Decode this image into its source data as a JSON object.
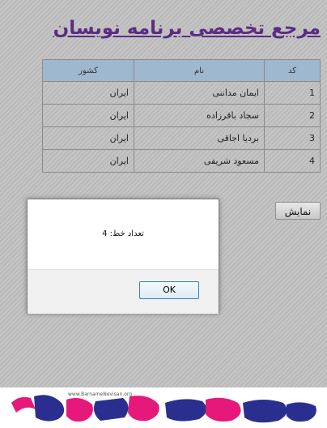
{
  "page": {
    "title": "مرجع تخصصی برنامه نویسان"
  },
  "table": {
    "headers": [
      "کد",
      "نام",
      "کشور"
    ],
    "rows": [
      {
        "code": "1",
        "name": "ایمان مداننی",
        "country": "ایران"
      },
      {
        "code": "2",
        "name": "سجاد باقرزاده",
        "country": "ایران"
      },
      {
        "code": "3",
        "name": "بردیا اجاقی",
        "country": "ایران"
      },
      {
        "code": "4",
        "name": "مسعود شریفی",
        "country": "ایران"
      }
    ]
  },
  "show_button": {
    "label": "نمایش"
  },
  "dialog": {
    "message": "تعداد خط: 4",
    "ok_label": "OK"
  },
  "footer_logo": {
    "url_text": "www.BarnameNevisan.org",
    "brand_text": "برنامه نویسان",
    "colors": {
      "blue": "#2a2f8f",
      "pink": "#e6197a"
    }
  }
}
